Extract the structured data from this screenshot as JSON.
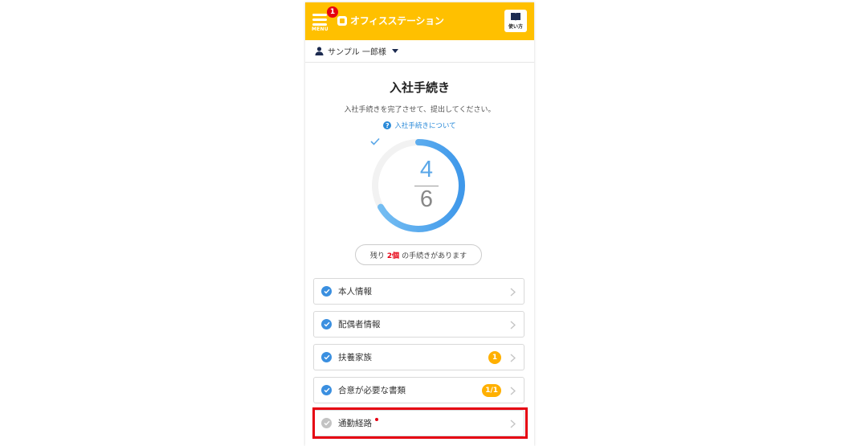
{
  "header": {
    "menu_label": "MENU",
    "menu_badge": "1",
    "logo_text": "オフィスステーション",
    "guide_label": "使い方",
    "brand_color": "#ffc000"
  },
  "user": {
    "name": "サンプル 一郎様",
    "icon": "person-icon"
  },
  "page": {
    "title": "入社手続き",
    "subtitle": "入社手続きを完了させて、提出してください。",
    "help_link": "入社手続きについて"
  },
  "progress": {
    "done": "4",
    "total": "6",
    "fraction": 0.667,
    "accent": "#5aa7e8"
  },
  "remaining": {
    "prefix": "残り",
    "count": "2個",
    "suffix": "の手続きがあります"
  },
  "items": [
    {
      "label": "本人情報",
      "status": "done",
      "badge": ""
    },
    {
      "label": "配偶者情報",
      "status": "done",
      "badge": ""
    },
    {
      "label": "扶養家族",
      "status": "done",
      "badge": "1"
    },
    {
      "label": "合意が必要な書類",
      "status": "done",
      "badge": "1/1"
    },
    {
      "label": "通勤経路",
      "status": "pending",
      "badge": "",
      "required": true
    }
  ]
}
